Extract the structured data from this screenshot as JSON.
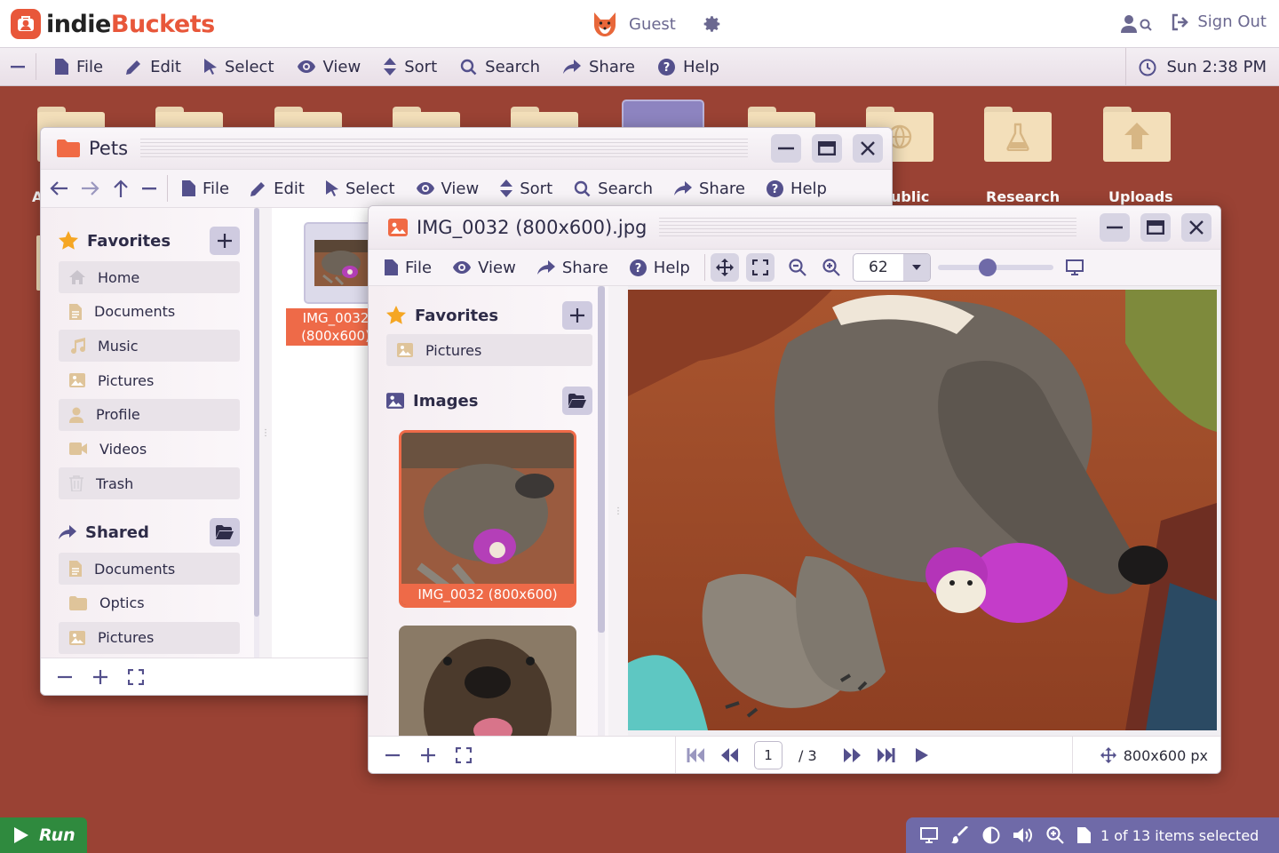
{
  "app": {
    "logo_part1": "indie",
    "logo_part2": "Buckets",
    "user": "Guest",
    "signout": "Sign Out"
  },
  "menubar": {
    "items": [
      "File",
      "Edit",
      "Select",
      "View",
      "Sort",
      "Search",
      "Share",
      "Help"
    ],
    "clock": "Sun 2:38 PM"
  },
  "desktop": {
    "icons": [
      {
        "label": "A",
        "glyph": "folder"
      },
      {
        "label": "",
        "glyph": "folder"
      },
      {
        "label": "",
        "glyph": "folder"
      },
      {
        "label": "",
        "glyph": "folder"
      },
      {
        "label": "",
        "glyph": "folder"
      },
      {
        "label": "",
        "glyph": "folder"
      },
      {
        "label": "",
        "glyph": "folder"
      },
      {
        "label": "ublic",
        "glyph": "globe-icon"
      },
      {
        "label": "Research",
        "glyph": "flask-icon"
      },
      {
        "label": "Uploads",
        "glyph": "upload-arrow-icon"
      }
    ]
  },
  "pets_window": {
    "title": "Pets",
    "toolbar": [
      "File",
      "Edit",
      "Select",
      "View",
      "Sort",
      "Search",
      "Share",
      "Help"
    ],
    "favorites_label": "Favorites",
    "favorites": [
      {
        "label": "Home",
        "icon": "home-icon"
      },
      {
        "label": "Documents",
        "icon": "document-icon"
      },
      {
        "label": "Music",
        "icon": "music-icon"
      },
      {
        "label": "Pictures",
        "icon": "picture-icon"
      },
      {
        "label": "Profile",
        "icon": "user-icon"
      },
      {
        "label": "Videos",
        "icon": "video-icon"
      },
      {
        "label": "Trash",
        "icon": "trash-icon"
      }
    ],
    "shared_label": "Shared",
    "shared": [
      {
        "label": "Documents",
        "icon": "document-icon"
      },
      {
        "label": "Optics",
        "icon": "folder-icon"
      },
      {
        "label": "Pictures",
        "icon": "picture-icon"
      }
    ],
    "file": {
      "name_line1": "IMG_0032",
      "name_line2": "(800x600)"
    }
  },
  "viewer_window": {
    "title": "IMG_0032 (800x600).jpg",
    "toolbar": [
      "File",
      "View",
      "Share",
      "Help"
    ],
    "zoom": "62",
    "zoom_slider_fraction": 0.42,
    "favorites_label": "Favorites",
    "favorites": [
      {
        "label": "Pictures",
        "icon": "picture-icon"
      }
    ],
    "images_label": "Images",
    "thumb1_caption": "IMG_0032 (800x600)",
    "page": "1",
    "page_total": "/ 3",
    "dimensions": "800x600 px"
  },
  "bottom": {
    "run": "Run",
    "status": "1 of 13 items selected"
  },
  "colors": {
    "accent": "#e8573a",
    "desktop": "#9a4234",
    "primary": "#54508c",
    "status_bar": "#6f6aa8",
    "run": "#2f8a3e"
  }
}
